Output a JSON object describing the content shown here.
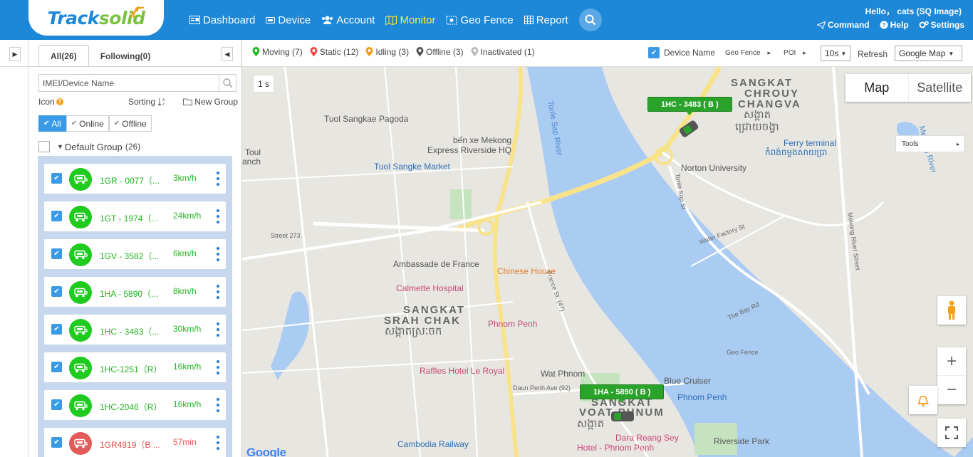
{
  "header": {
    "logo": {
      "part1": "Track",
      "part2": "solid"
    },
    "nav": [
      {
        "label": "Dashboard",
        "icon": "dashboard-icon"
      },
      {
        "label": "Device",
        "icon": "device-icon"
      },
      {
        "label": "Account",
        "icon": "users-icon"
      },
      {
        "label": "Monitor",
        "icon": "map-icon"
      },
      {
        "label": "Geo Fence",
        "icon": "geofence-icon"
      },
      {
        "label": "Report",
        "icon": "table-icon"
      }
    ],
    "greeting": "Hello， cats (SQ Image)",
    "links": [
      {
        "label": "Command",
        "icon": "send-icon"
      },
      {
        "label": "Help",
        "icon": "help-icon"
      },
      {
        "label": "Settings",
        "icon": "gears-icon"
      }
    ]
  },
  "panel": {
    "tabs": [
      {
        "label": "All(26)"
      },
      {
        "label": "Following(0)"
      }
    ],
    "search_placeholder": "IMEI/Device Name",
    "icon_label": "Icon",
    "sorting_label": "Sorting",
    "new_group_label": "New Group",
    "filters": [
      {
        "label": "All"
      },
      {
        "label": "Online"
      },
      {
        "label": "Offline"
      }
    ],
    "group": {
      "name": "Default Group",
      "count": "(26)"
    },
    "devices": [
      {
        "name": "1GR - 0077（...",
        "speed": "3km/h",
        "status": "moving"
      },
      {
        "name": "1GT - 1974（...",
        "speed": "24km/h",
        "status": "moving"
      },
      {
        "name": "1GV - 3582（...",
        "speed": "6km/h",
        "status": "moving"
      },
      {
        "name": "1HA - 5890（...",
        "speed": "8km/h",
        "status": "moving"
      },
      {
        "name": "1HC - 3483（...",
        "speed": "30km/h",
        "status": "moving"
      },
      {
        "name": "1HC-1251（R）",
        "speed": "16km/h",
        "status": "moving"
      },
      {
        "name": "1HC-2046（R）",
        "speed": "16km/h",
        "status": "moving"
      },
      {
        "name": "1GR4919（B ...",
        "speed": "57min",
        "status": "static"
      }
    ]
  },
  "map_toolbar": {
    "statuses": [
      {
        "label": "Moving (7)",
        "color": "#22b522"
      },
      {
        "label": "Static (12)",
        "color": "#e84c4c"
      },
      {
        "label": "Idling (3)",
        "color": "#f39a1b"
      },
      {
        "label": "Offline (3)",
        "color": "#555555"
      },
      {
        "label": "Inactivated (1)",
        "color": "#bbbbbb"
      }
    ],
    "device_name_label": "Device Name",
    "geo_fence_label": "Geo Fence",
    "poi_label": "POI",
    "interval": "10s",
    "refresh_label": "Refresh",
    "map_provider": "Google Map"
  },
  "map": {
    "seconds": "1 s",
    "map_types": [
      {
        "label": "Map"
      },
      {
        "label": "Satellite"
      }
    ],
    "tools_label": "Tools",
    "google": "Google",
    "device_tags": [
      {
        "label": "1HC - 3483 ( B )"
      },
      {
        "label": "1HA - 5890 ( B )"
      }
    ],
    "labels": {
      "tuol_sangkae_pagoda": "Tuol Sangkae Pagoda",
      "ben_xe_mekong_1": "bến xe Mekong",
      "ben_xe_mekong_2": "Express Riverside HQ",
      "toul_1": "Toul",
      "toul_2": "anch",
      "tuol_sangke_market": "Tuol Sangke Market",
      "ambassade": "Ambassade de France",
      "chinese_house": "Chinese House",
      "calmette": "Calmette Hospital",
      "sangkat_srah_chak_1": "SANGKAT",
      "sangkat_srah_chak_2": "SRAH CHAK",
      "sangkat_srah_chak_km": "សង្កាតស្រៈចក",
      "phnom_penh": "Phnom Penh",
      "raffles": "Raffles Hotel Le Royal",
      "wat_phnom": "Wat Phnom",
      "sangkat_voat_1": "SANGKAT",
      "sangkat_voat_2": "VOAT PHNUM",
      "sangkat_voat_km": "សង្កាត",
      "blue_cruiser": "Blue Cruiser",
      "phnom_penh_2": "Phnom Penh",
      "dara_1": "Dara Reang Sey",
      "dara_2": "Hotel - Phnom Penh",
      "riverside_park": "Riverside Park",
      "cambodia_railway": "Cambodia Railway",
      "sangkat_chrouy_1": "SANGKAT",
      "sangkat_chrouy_2": "CHROUY",
      "sangkat_chrouy_3": "CHANGVA",
      "sangkat_chrouy_km1": "សង្កាត",
      "sangkat_chrouy_km2": "ជ្រោយចង្វា",
      "ferry": "Ferry terminal",
      "ferry_km": "កំពង់ចម្លងសាយប្រា",
      "norton": "Norton University",
      "tonle_sap_river": "Tonle Sap River",
      "mekong_river": "Mekong River",
      "street_273": "Street 273",
      "france_st": "France St. (47)",
      "tonle_sap_st": "Tonle Sap St",
      "water_factory": "Water Factory St",
      "mekong_river_street": "Mekong River Street",
      "the_bay_rd": "The Bay Rd",
      "geo_fence": "Geo Fence",
      "daun_penh": "Daun Penh Ave (92)"
    }
  }
}
